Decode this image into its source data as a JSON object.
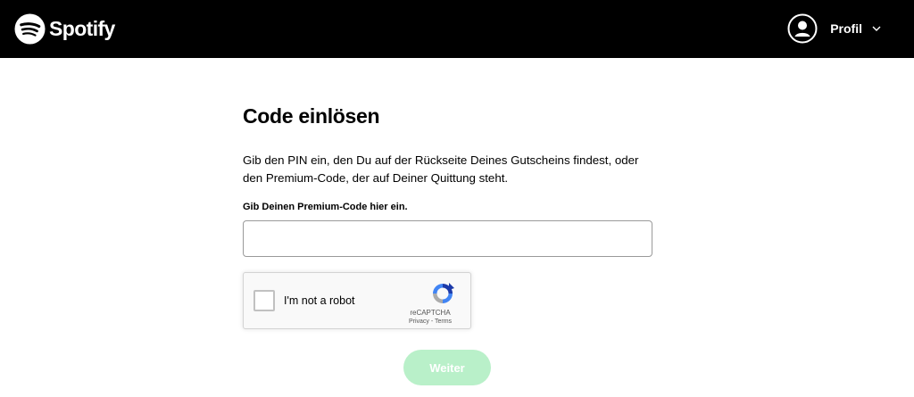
{
  "header": {
    "brand": "Spotify",
    "profile_label": "Profil",
    "logo_icon": "spotify-logo-icon",
    "avatar_icon": "user-circle-icon",
    "dropdown_icon": "chevron-down-icon"
  },
  "main": {
    "title": "Code einlösen",
    "intro": "Gib den PIN ein, den Du auf der Rückseite Deines Gutscheins findest, oder den Premium-Code, der auf Deiner Quittung steht.",
    "field_label": "Gib Deinen Premium-Code hier ein.",
    "code_value": "",
    "submit_label": "Weiter"
  },
  "recaptcha": {
    "label": "I'm not a robot",
    "brand": "reCAPTCHA",
    "privacy": "Privacy",
    "separator": " - ",
    "terms": "Terms",
    "checked": false
  },
  "colors": {
    "header_bg": "#000000",
    "button_disabled_bg": "#b9f0c9",
    "button_text": "#ffffff"
  }
}
